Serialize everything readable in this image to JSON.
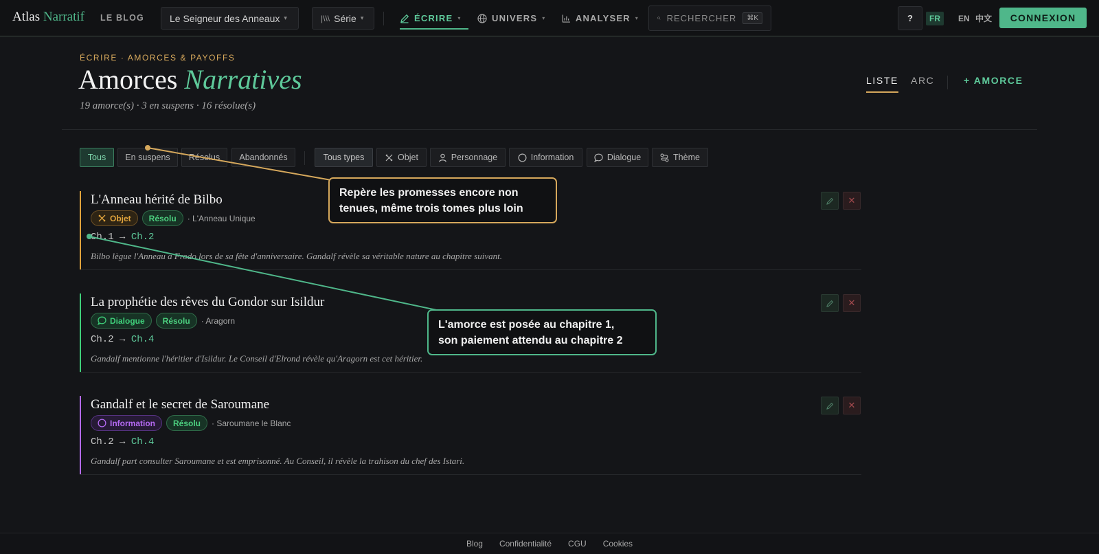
{
  "header": {
    "brand_main": "Atlas",
    "brand_accent": "Narratif",
    "blog": "LE BLOG",
    "project": "Le Seigneur des Anneaux",
    "series": "Série",
    "nav": {
      "ecrire": "ÉCRIRE",
      "univers": "UNIVERS",
      "analyser": "ANALYSER"
    },
    "search_placeholder": "RECHERCHER",
    "search_shortcut": "⌘K",
    "help": "?",
    "languages": [
      "FR",
      "EN",
      "中文"
    ],
    "active_language": "FR",
    "login": "CONNEXION"
  },
  "page": {
    "eyebrow": "ÉCRIRE · AMORCES & PAYOFFS",
    "title_main": "Amorces",
    "title_accent": "Narratives",
    "subtitle": "19 amorce(s) · 3 en suspens · 16 résolue(s)",
    "view_tabs": [
      "LISTE",
      "ARC"
    ],
    "active_view": "LISTE",
    "add_button": "+ AMORCE"
  },
  "filters": {
    "status": [
      "Tous",
      "En suspens",
      "Résolus",
      "Abandonnés"
    ],
    "active_status": "Tous",
    "types": [
      "Tous types",
      "Objet",
      "Personnage",
      "Information",
      "Dialogue",
      "Thème"
    ],
    "active_type": "Tous types"
  },
  "colors": {
    "accent": "#4fb78a",
    "gold": "#d6a85c",
    "objet": "#e0a33c",
    "dialogue": "#3fcf7a",
    "information": "#b46af2",
    "resolu": "#4ccf7f"
  },
  "setups": [
    {
      "title": "L'Anneau hérité de Bilbo",
      "type": "Objet",
      "type_icon": "sword-icon",
      "status": "Résolu",
      "character": "· L'Anneau Unique",
      "from": "Ch.1",
      "arrow": "→",
      "to": "Ch.2",
      "description": "Bilbo lègue l'Anneau à Frodo lors de sa fête d'anniversaire. Gandalf révèle sa véritable nature au chapitre suivant."
    },
    {
      "title": "La prophétie des rêves du Gondor sur Isildur",
      "type": "Dialogue",
      "type_icon": "speech-bubble-icon",
      "status": "Résolu",
      "character": "· Aragorn",
      "from": "Ch.2",
      "arrow": "→",
      "to": "Ch.4",
      "description": "Gandalf mentionne l'héritier d'Isildur. Le Conseil d'Elrond révèle qu'Aragorn est cet héritier."
    },
    {
      "title": "Gandalf et le secret de Saroumane",
      "type": "Information",
      "type_icon": "circle-icon",
      "status": "Résolu",
      "character": "· Saroumane le Blanc",
      "from": "Ch.2",
      "arrow": "→",
      "to": "Ch.4",
      "description": "Gandalf part consulter Saroumane et est emprisonné. Au Conseil, il révèle la trahison du chef des Istari."
    }
  ],
  "callouts": {
    "gold": [
      "Repère les promesses encore non",
      "tenues, même trois tomes plus loin"
    ],
    "green": [
      "L'amorce est posée au chapitre 1,",
      "son paiement attendu au chapitre 2"
    ]
  },
  "footer": [
    "Blog",
    "Confidentialité",
    "CGU",
    "Cookies"
  ]
}
